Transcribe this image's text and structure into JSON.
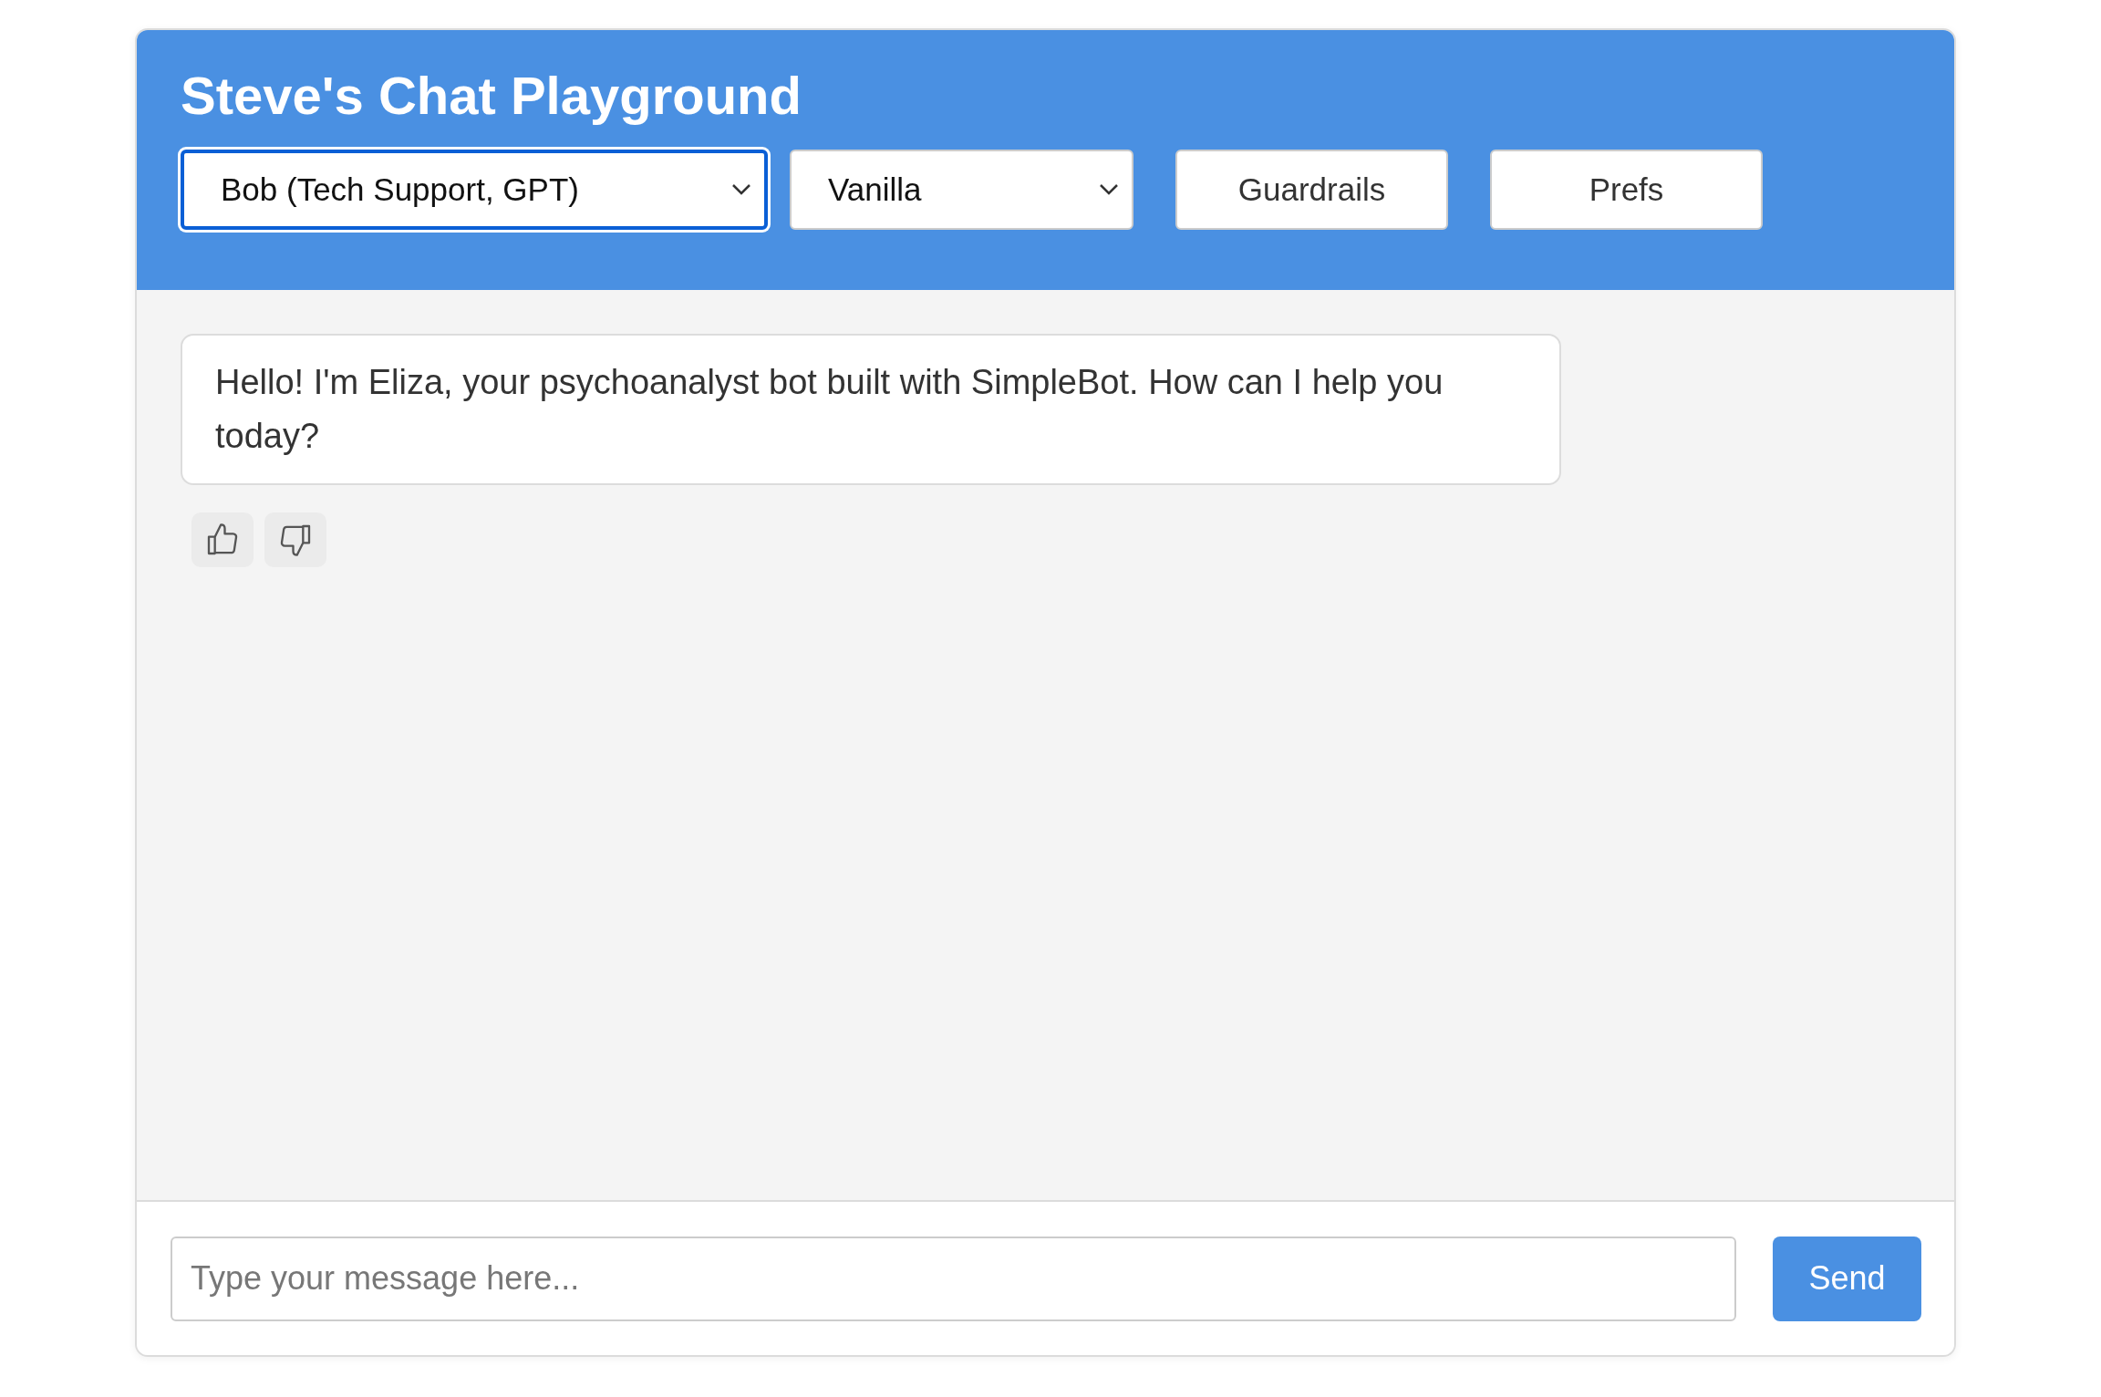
{
  "header": {
    "title": "Steve's Chat Playground"
  },
  "selects": [
    {
      "value": "Bob (Tech Support, GPT)",
      "focused": true
    },
    {
      "value": "Vanilla",
      "focused": false
    }
  ],
  "buttons": [
    "Guardrails",
    "Prefs"
  ],
  "messages": [
    {
      "text": "Hello! I'm Eliza, your psychoanalyst bot built with SimpleBot. How can I help you today?"
    }
  ],
  "composer": {
    "placeholder": "Type your message here...",
    "send": "Send"
  }
}
